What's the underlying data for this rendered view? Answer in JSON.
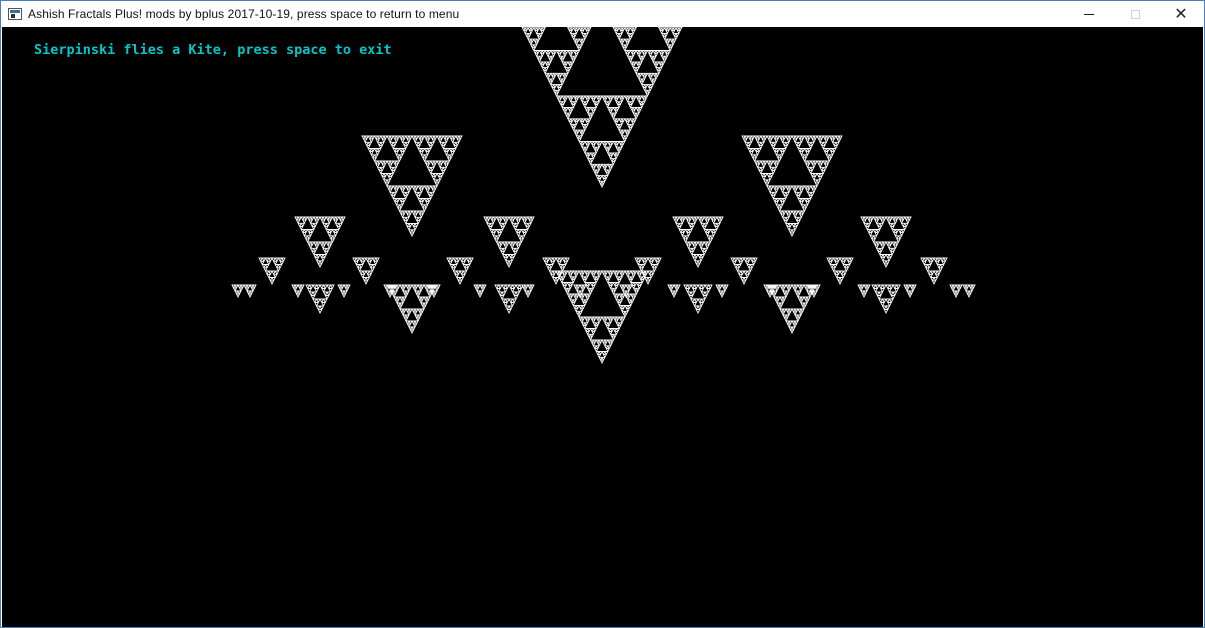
{
  "window": {
    "title": "Ashish Fractals Plus! mods by bplus 2017-10-19, press space to return to menu",
    "controls": {
      "minimize": "minimize",
      "maximize": "maximize",
      "close": "✕"
    }
  },
  "game": {
    "status_text": "Sierpinski flies a Kite, press space to exit",
    "colors": {
      "background": "#000000",
      "fractal": "#ffffff",
      "status_text": "#00c8c8"
    }
  }
}
